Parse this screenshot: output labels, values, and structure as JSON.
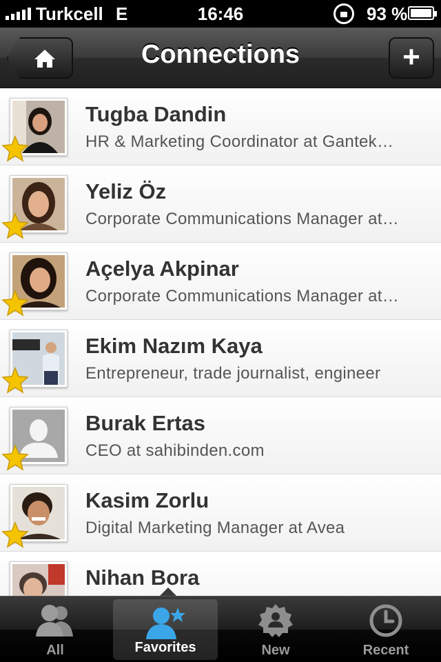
{
  "status_bar": {
    "carrier": "Turkcell",
    "network": "E",
    "time": "16:46",
    "battery": "93 %"
  },
  "nav": {
    "title": "Connections",
    "home_icon": "home-icon",
    "add_label": "+"
  },
  "connections": [
    {
      "name": "Tugba Dandin",
      "headline": "HR & Marketing Coordinator at Gantek…",
      "favorite": true
    },
    {
      "name": "Yeliz Öz",
      "headline": "Corporate Communications Manager at…",
      "favorite": true
    },
    {
      "name": "Açelya Akpinar",
      "headline": "Corporate Communications Manager at…",
      "favorite": true
    },
    {
      "name": "Ekim Nazım Kaya",
      "headline": "Entrepreneur, trade journalist, engineer",
      "favorite": true
    },
    {
      "name": "Burak Ertas",
      "headline": "CEO at sahibinden.com",
      "favorite": true
    },
    {
      "name": "Kasim Zorlu",
      "headline": "Digital Marketing Manager at Avea",
      "favorite": true
    },
    {
      "name": "Nihan Bora",
      "headline": "",
      "favorite": true
    }
  ],
  "tabs": [
    {
      "label": "All",
      "icon": "people-icon"
    },
    {
      "label": "Favorites",
      "icon": "person-star-icon",
      "selected": true
    },
    {
      "label": "New",
      "icon": "badge-person-icon"
    },
    {
      "label": "Recent",
      "icon": "clock-icon"
    }
  ],
  "colors": {
    "star": "#f5c400",
    "favorites_icon": "#3aa6e8"
  }
}
